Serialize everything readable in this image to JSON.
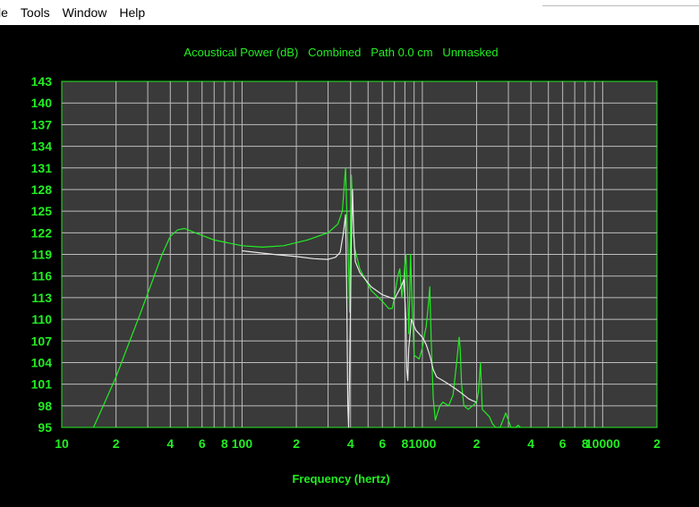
{
  "menubar": {
    "items": [
      "le",
      "Tools",
      "Window",
      "Help"
    ]
  },
  "colors": {
    "background": "#000000",
    "plot_bg": "#3a3a3a",
    "grid": "#bdbdbd",
    "accent": "#22ee22",
    "curve_white": "#e8e8e8"
  },
  "chart_data": {
    "type": "line",
    "title": "Acoustical Power (dB)   Combined   Path 0.0 cm   Unmasked",
    "xlabel": "Frequency (hertz)",
    "ylabel": "",
    "x_scale": "log",
    "xlim": [
      10,
      20000
    ],
    "ylim": [
      95,
      143
    ],
    "y_ticks": [
      "143",
      "140",
      "137",
      "134",
      "131",
      "128",
      "125",
      "122",
      "119",
      "116",
      "113",
      "110",
      "107",
      "104",
      "101",
      "98",
      "95"
    ],
    "x_ticks": [
      {
        "x": 10,
        "label": "10"
      },
      {
        "x": 20,
        "label": "2"
      },
      {
        "x": 40,
        "label": "4"
      },
      {
        "x": 60,
        "label": "6"
      },
      {
        "x": 80,
        "label": "8"
      },
      {
        "x": 100,
        "label": "100"
      },
      {
        "x": 200,
        "label": "2"
      },
      {
        "x": 400,
        "label": "4"
      },
      {
        "x": 600,
        "label": "6"
      },
      {
        "x": 800,
        "label": "8"
      },
      {
        "x": 1000,
        "label": "1000"
      },
      {
        "x": 2000,
        "label": "2"
      },
      {
        "x": 4000,
        "label": "4"
      },
      {
        "x": 6000,
        "label": "6"
      },
      {
        "x": 8000,
        "label": "8"
      },
      {
        "x": 10000,
        "label": "10000"
      },
      {
        "x": 20000,
        "label": "2"
      }
    ],
    "grid": true,
    "series": [
      {
        "color": "#22ee22",
        "points": [
          [
            15,
            95
          ],
          [
            17,
            98
          ],
          [
            20,
            102
          ],
          [
            23,
            106
          ],
          [
            27,
            110.5
          ],
          [
            32,
            115.5
          ],
          [
            36,
            119
          ],
          [
            40,
            121.5
          ],
          [
            44,
            122.4
          ],
          [
            48,
            122.6
          ],
          [
            55,
            122
          ],
          [
            70,
            121
          ],
          [
            100,
            120.2
          ],
          [
            130,
            120
          ],
          [
            170,
            120.2
          ],
          [
            230,
            121
          ],
          [
            300,
            122
          ],
          [
            340,
            123.2
          ],
          [
            360,
            125
          ],
          [
            370,
            129
          ],
          [
            375,
            131
          ],
          [
            382,
            124
          ],
          [
            390,
            117
          ],
          [
            395,
            111
          ],
          [
            398,
            120
          ],
          [
            404,
            130
          ],
          [
            410,
            126
          ],
          [
            420,
            120
          ],
          [
            450,
            117
          ],
          [
            520,
            114
          ],
          [
            600,
            112.5
          ],
          [
            650,
            111.5
          ],
          [
            680,
            111.5
          ],
          [
            700,
            113
          ],
          [
            730,
            116
          ],
          [
            750,
            117
          ],
          [
            770,
            113
          ],
          [
            790,
            116
          ],
          [
            810,
            119
          ],
          [
            830,
            113
          ],
          [
            840,
            108
          ],
          [
            850,
            113
          ],
          [
            860,
            119
          ],
          [
            875,
            113
          ],
          [
            900,
            105
          ],
          [
            960,
            104.5
          ],
          [
            1000,
            106
          ],
          [
            1030,
            108
          ],
          [
            1050,
            109
          ],
          [
            1080,
            112
          ],
          [
            1100,
            114.5
          ],
          [
            1120,
            107
          ],
          [
            1150,
            99
          ],
          [
            1180,
            96
          ],
          [
            1250,
            98
          ],
          [
            1300,
            98.5
          ],
          [
            1400,
            98
          ],
          [
            1480,
            99.5
          ],
          [
            1550,
            104
          ],
          [
            1600,
            107.5
          ],
          [
            1620,
            106
          ],
          [
            1650,
            101
          ],
          [
            1700,
            98
          ],
          [
            1800,
            97.5
          ],
          [
            1900,
            98
          ],
          [
            2000,
            98.5
          ],
          [
            2050,
            100
          ],
          [
            2100,
            104
          ],
          [
            2150,
            97.5
          ],
          [
            2250,
            97
          ],
          [
            2350,
            96.5
          ],
          [
            2450,
            95.5
          ],
          [
            2550,
            95
          ],
          [
            2700,
            95
          ],
          [
            2900,
            97
          ],
          [
            3000,
            96
          ],
          [
            3100,
            95
          ],
          [
            3300,
            95
          ],
          [
            3400,
            95.3
          ],
          [
            3500,
            95
          ]
        ]
      },
      {
        "color": "#e8e8e8",
        "points": [
          [
            100,
            119.5
          ],
          [
            150,
            119
          ],
          [
            200,
            118.7
          ],
          [
            250,
            118.4
          ],
          [
            300,
            118.3
          ],
          [
            330,
            118.6
          ],
          [
            350,
            119.3
          ],
          [
            365,
            122
          ],
          [
            375,
            124.5
          ],
          [
            380,
            115
          ],
          [
            386,
            98
          ],
          [
            390,
            95
          ],
          [
            394,
            101
          ],
          [
            400,
            113
          ],
          [
            405,
            123
          ],
          [
            410,
            128
          ],
          [
            416,
            122
          ],
          [
            425,
            118
          ],
          [
            450,
            116.5
          ],
          [
            520,
            114.5
          ],
          [
            600,
            113.4
          ],
          [
            700,
            112.8
          ],
          [
            760,
            114.5
          ],
          [
            790,
            115.5
          ],
          [
            810,
            110
          ],
          [
            820,
            103
          ],
          [
            830,
            101.5
          ],
          [
            840,
            106
          ],
          [
            870,
            110
          ],
          [
            920,
            108.5
          ],
          [
            1000,
            107.5
          ],
          [
            1050,
            106.5
          ],
          [
            1100,
            105
          ],
          [
            1150,
            103
          ],
          [
            1200,
            102
          ],
          [
            1300,
            101.5
          ],
          [
            1400,
            101
          ],
          [
            1500,
            100.5
          ],
          [
            1600,
            100
          ],
          [
            1700,
            99.5
          ],
          [
            1800,
            99
          ],
          [
            1900,
            98.7
          ],
          [
            2000,
            98.5
          ]
        ]
      }
    ]
  }
}
